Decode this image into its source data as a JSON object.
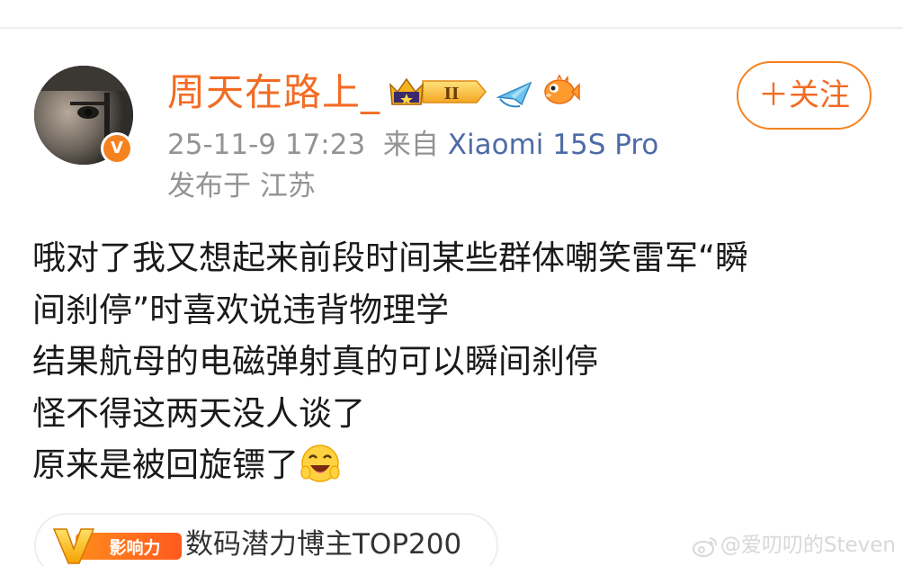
{
  "post": {
    "author": {
      "username": "周天在路上_",
      "avatar": "avatar-photo",
      "verified_badge": "V",
      "badges": [
        "crown-level-badge",
        "paper-plane-badge",
        "pufferfish-badge"
      ],
      "crown_level": "II"
    },
    "follow_button": {
      "label": "＋关注"
    },
    "meta": {
      "timestamp": "25-11-9 17:23",
      "source_prefix": "来自",
      "source_device": "Xiaomi 15S Pro",
      "location": "发布于 江苏"
    },
    "body_lines": [
      "哦对了我又想起来前段时间某些群体嘲笑雷军“瞬",
      "间刹停”时喜欢说违背物理学",
      "结果航母的电磁弹射真的可以瞬间刹停",
      "怪不得这两天没人谈了",
      "原来是被回旋镖了"
    ],
    "trailing_emoji": "laughing-face-emoji",
    "influence": {
      "tag_label": "影响力",
      "text": "数码潜力博主TOP200"
    }
  },
  "watermark": {
    "text": "@爱叨叨的Steven"
  },
  "colors": {
    "username": "#f36b23",
    "accent_orange": "#f5821f",
    "meta_gray": "#939393",
    "device_blue": "#4d6ba5",
    "body_text": "#1a1a1a"
  }
}
